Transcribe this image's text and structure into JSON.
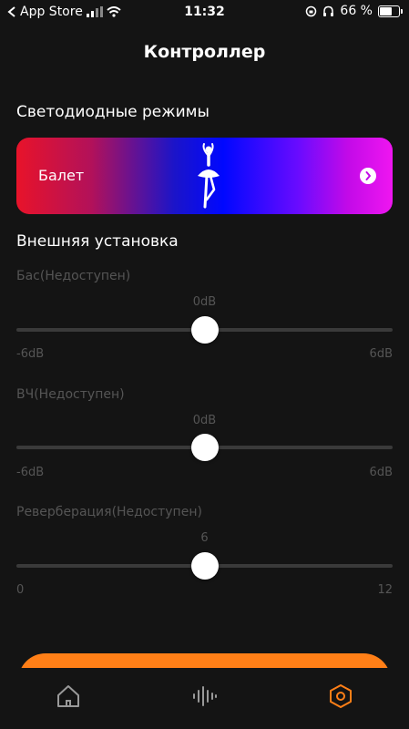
{
  "status_bar": {
    "carrier": "App Store",
    "time": "11:32",
    "battery_percent": "66 %",
    "battery_level": 0.66
  },
  "header": {
    "title": "Контроллер"
  },
  "led_section": {
    "title": "Светодиодные режимы",
    "current_mode": "Балет"
  },
  "external_section": {
    "title": "Внешняя установка",
    "sliders": [
      {
        "label": "Бас(Недоступен)",
        "value": "0dB",
        "min_label": "-6dB",
        "max_label": "6dB",
        "position": 0.5
      },
      {
        "label": "ВЧ(Недоступен)",
        "value": "0dB",
        "min_label": "-6dB",
        "max_label": "6dB",
        "position": 0.5
      },
      {
        "label": "Реверберация(Недоступен)",
        "value": "6",
        "min_label": "0",
        "max_label": "12",
        "position": 0.5
      }
    ]
  },
  "tabs": [
    {
      "icon": "home-icon",
      "active": false
    },
    {
      "icon": "waveform-icon",
      "active": false
    },
    {
      "icon": "settings-hex-icon",
      "active": true
    }
  ],
  "colors": {
    "accent": "#ff7f17",
    "background": "#141414",
    "disabled_text": "#555555"
  }
}
